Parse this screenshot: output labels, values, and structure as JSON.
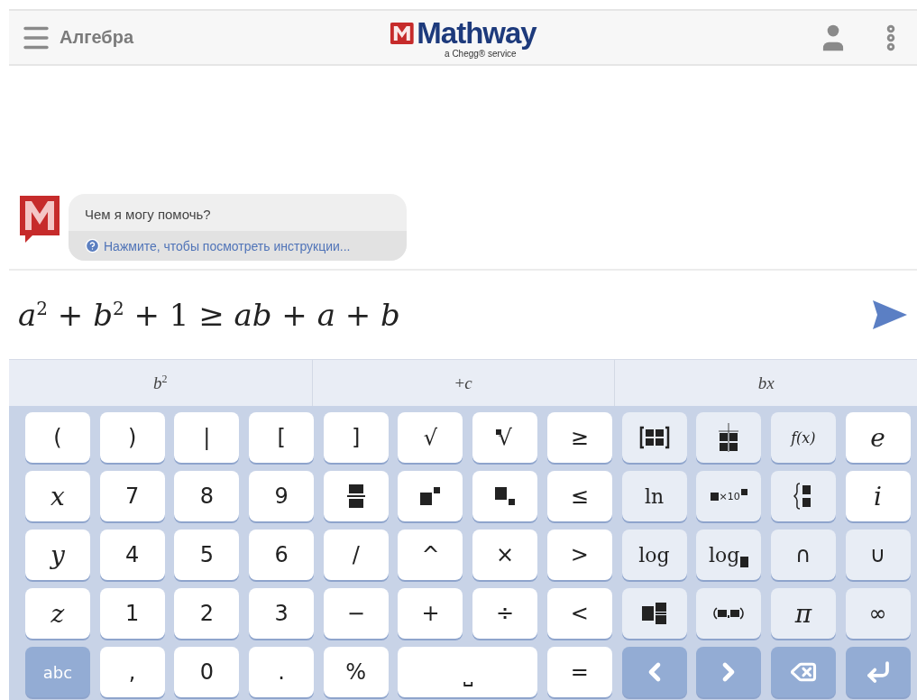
{
  "header": {
    "subject": "Алгебра",
    "logo": "Mathway",
    "tagline": "a Chegg® service"
  },
  "chat": {
    "message": "Чем я могу помочь?",
    "link": "Нажмите, чтобы посмотреть инструкции..."
  },
  "input": {
    "value": "*a*$^{2}$ + *b*$^{2}$ + 1 ≥ *ab* + *a* + *b*"
  },
  "suggestions": [
    "*b*$^{2}$",
    "+*c*",
    "*bx*"
  ],
  "keys": [
    {
      "kind": "text",
      "label": "("
    },
    {
      "kind": "text",
      "label": ")"
    },
    {
      "kind": "text",
      "label": "|"
    },
    {
      "kind": "text",
      "label": "["
    },
    {
      "kind": "text",
      "label": "]"
    },
    {
      "kind": "text",
      "label": "√"
    },
    {
      "kind": "nthroot",
      "label": "√"
    },
    {
      "kind": "text",
      "label": "≥"
    },
    {
      "kind": "matrix"
    },
    {
      "kind": "table"
    },
    {
      "kind": "func",
      "label": "f(x)"
    },
    {
      "kind": "var",
      "label": "e"
    },
    {
      "kind": "var",
      "label": "x"
    },
    {
      "kind": "text",
      "label": "7"
    },
    {
      "kind": "text",
      "label": "8"
    },
    {
      "kind": "text",
      "label": "9"
    },
    {
      "kind": "fraction"
    },
    {
      "kind": "power"
    },
    {
      "kind": "subscript"
    },
    {
      "kind": "text",
      "label": "≤"
    },
    {
      "kind": "func",
      "label": "ln"
    },
    {
      "kind": "sci",
      "label": "×10"
    },
    {
      "kind": "piecewise"
    },
    {
      "kind": "var",
      "label": "i"
    },
    {
      "kind": "var",
      "label": "y"
    },
    {
      "kind": "text",
      "label": "4"
    },
    {
      "kind": "text",
      "label": "5"
    },
    {
      "kind": "text",
      "label": "6"
    },
    {
      "kind": "text",
      "label": "/"
    },
    {
      "kind": "text",
      "label": "^"
    },
    {
      "kind": "text",
      "label": "×"
    },
    {
      "kind": "text",
      "label": ">"
    },
    {
      "kind": "func",
      "label": "log"
    },
    {
      "kind": "logbase",
      "label": "log"
    },
    {
      "kind": "functext",
      "label": "∩"
    },
    {
      "kind": "functext",
      "label": "∪"
    },
    {
      "kind": "var",
      "label": "z"
    },
    {
      "kind": "text",
      "label": "1"
    },
    {
      "kind": "text",
      "label": "2"
    },
    {
      "kind": "text",
      "label": "3"
    },
    {
      "kind": "text",
      "label": "−"
    },
    {
      "kind": "text",
      "label": "+"
    },
    {
      "kind": "text",
      "label": "÷"
    },
    {
      "kind": "text",
      "label": "<"
    },
    {
      "kind": "mixed"
    },
    {
      "kind": "point"
    },
    {
      "kind": "funcvar",
      "label": "π"
    },
    {
      "kind": "functext",
      "label": "∞"
    },
    {
      "kind": "action",
      "label": "abc"
    },
    {
      "kind": "text",
      "label": ","
    },
    {
      "kind": "text",
      "label": "0"
    },
    {
      "kind": "text",
      "label": "."
    },
    {
      "kind": "text",
      "label": "%"
    },
    {
      "kind": "space",
      "label": "⎵"
    },
    {
      "kind": "text",
      "label": "="
    },
    {
      "kind": "left"
    },
    {
      "kind": "right"
    },
    {
      "kind": "backspace"
    },
    {
      "kind": "enter"
    }
  ]
}
